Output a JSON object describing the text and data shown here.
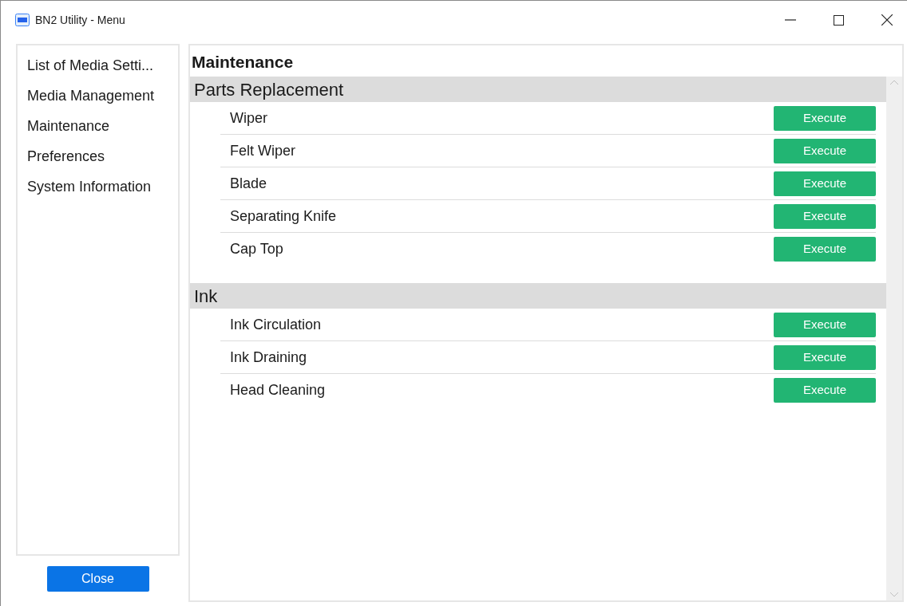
{
  "window": {
    "title": "BN2 Utility - Menu"
  },
  "sidebar": {
    "items": [
      {
        "label": "List of Media Setti..."
      },
      {
        "label": "Media Management"
      },
      {
        "label": "Maintenance"
      },
      {
        "label": "Preferences"
      },
      {
        "label": "System Information"
      }
    ]
  },
  "close_button": "Close",
  "main": {
    "title": "Maintenance",
    "sections": [
      {
        "title": "Parts Replacement",
        "rows": [
          {
            "label": "Wiper",
            "button": "Execute"
          },
          {
            "label": "Felt Wiper",
            "button": "Execute"
          },
          {
            "label": "Blade",
            "button": "Execute"
          },
          {
            "label": "Separating Knife",
            "button": "Execute"
          },
          {
            "label": "Cap Top",
            "button": "Execute"
          }
        ]
      },
      {
        "title": "Ink",
        "rows": [
          {
            "label": "Ink Circulation",
            "button": "Execute"
          },
          {
            "label": "Ink Draining",
            "button": "Execute"
          },
          {
            "label": "Head Cleaning",
            "button": "Execute"
          }
        ]
      }
    ]
  }
}
